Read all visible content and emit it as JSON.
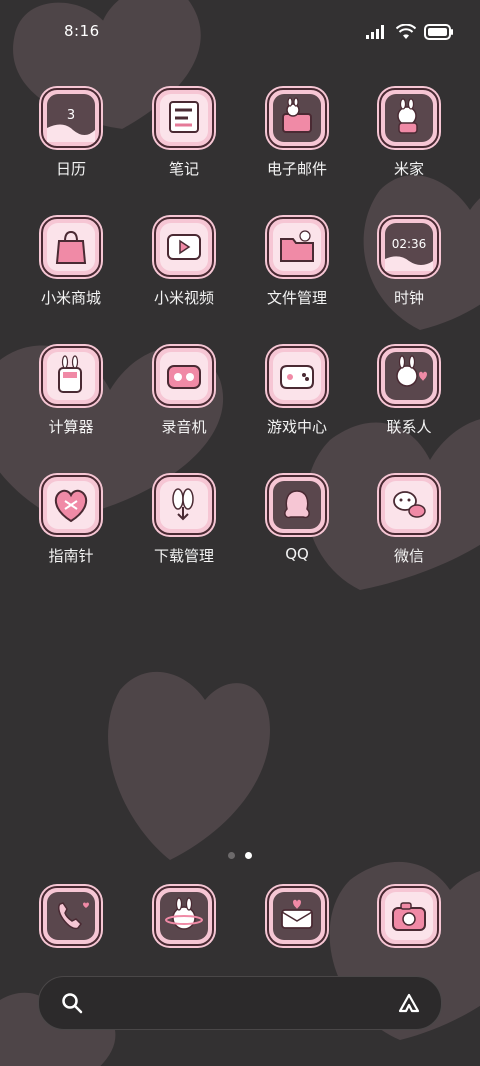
{
  "status_bar": {
    "time": "8:16",
    "battery_icon": "battery-icon",
    "wifi_icon": "wifi-icon",
    "signal_icon": "signal-icon"
  },
  "apps": [
    {
      "label": "日历",
      "icon": "calendar-icon",
      "badge": "3"
    },
    {
      "label": "笔记",
      "icon": "notes-icon"
    },
    {
      "label": "电子邮件",
      "icon": "email-icon"
    },
    {
      "label": "米家",
      "icon": "mijia-icon"
    },
    {
      "label": "小米商城",
      "icon": "shop-icon"
    },
    {
      "label": "小米视频",
      "icon": "video-icon"
    },
    {
      "label": "文件管理",
      "icon": "files-icon"
    },
    {
      "label": "时钟",
      "icon": "clock-icon",
      "badge": "02:36"
    },
    {
      "label": "计算器",
      "icon": "calculator-icon"
    },
    {
      "label": "录音机",
      "icon": "recorder-icon"
    },
    {
      "label": "游戏中心",
      "icon": "game-center-icon"
    },
    {
      "label": "联系人",
      "icon": "contacts-icon"
    },
    {
      "label": "指南针",
      "icon": "compass-icon"
    },
    {
      "label": "下载管理",
      "icon": "download-icon"
    },
    {
      "label": "QQ",
      "icon": "qq-icon"
    },
    {
      "label": "微信",
      "icon": "wechat-icon"
    }
  ],
  "page_indicator": {
    "count": 2,
    "active": 2
  },
  "dock": [
    {
      "icon": "phone-icon"
    },
    {
      "icon": "browser-icon"
    },
    {
      "icon": "messages-icon"
    },
    {
      "icon": "camera-icon"
    }
  ],
  "search": {
    "left_icon": "search-icon",
    "right_icon": "assistant-icon"
  },
  "colors": {
    "background": "#333132",
    "tile": "#f6c6d4",
    "tile_inner": "#fbe3ea",
    "heart": "#4f4649"
  }
}
